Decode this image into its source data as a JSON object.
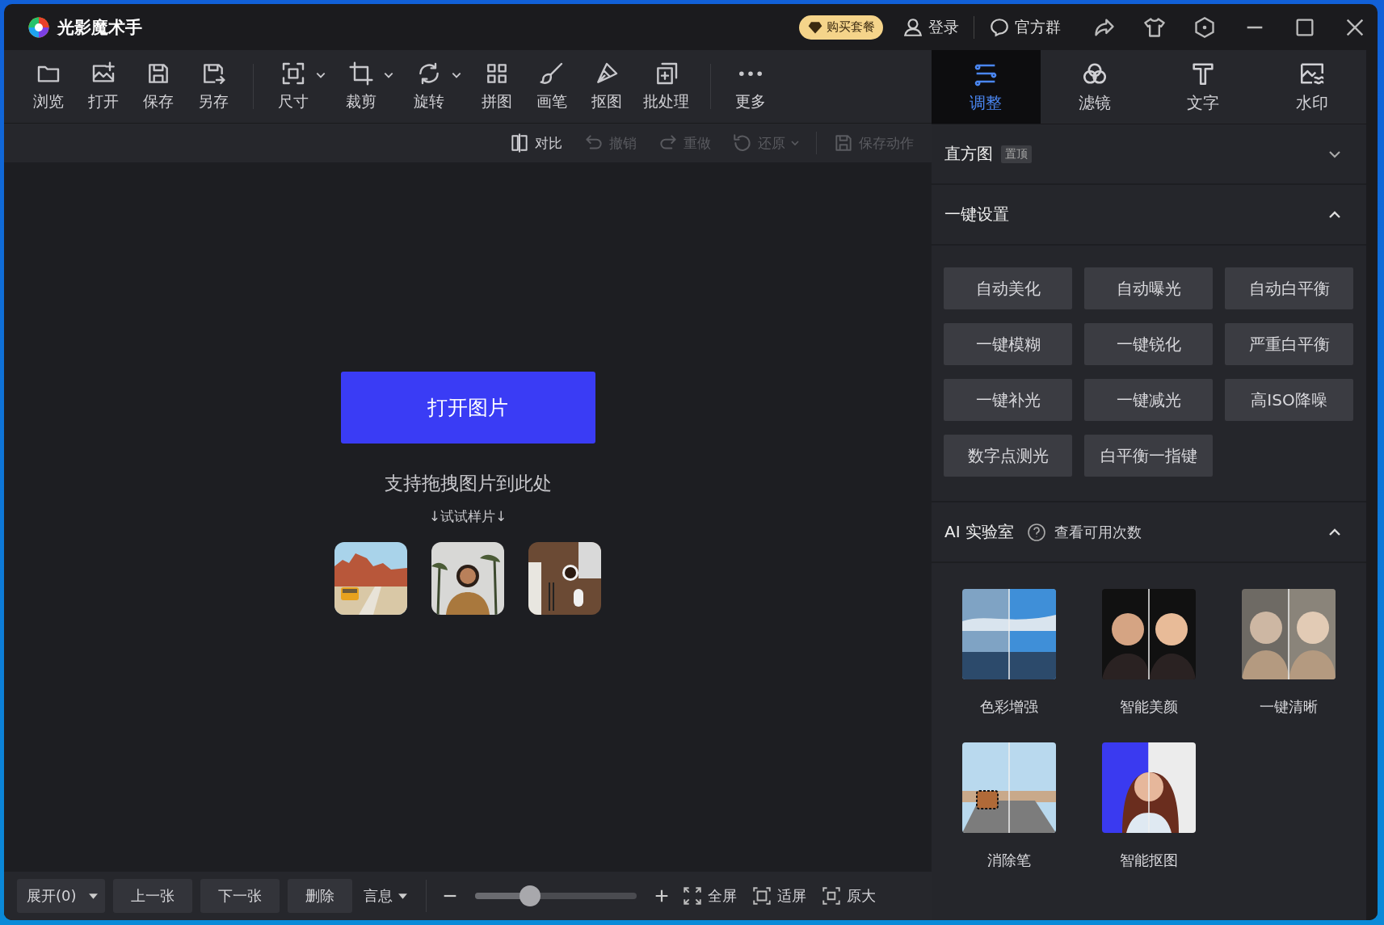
{
  "app": {
    "title": "光影魔术手"
  },
  "header": {
    "purchase": "购买套餐",
    "login": "登录",
    "group": "官方群"
  },
  "toolbar": [
    {
      "items": [
        {
          "label": "浏览",
          "kind": "folder",
          "dropdown": false
        },
        {
          "label": "打开",
          "kind": "image-add",
          "dropdown": false
        },
        {
          "label": "保存",
          "kind": "save",
          "dropdown": false
        },
        {
          "label": "另存",
          "kind": "save-as",
          "dropdown": false
        }
      ]
    },
    {
      "items": [
        {
          "label": "尺寸",
          "kind": "size",
          "dropdown": true
        },
        {
          "label": "裁剪",
          "kind": "crop",
          "dropdown": true
        },
        {
          "label": "旋转",
          "kind": "rotate",
          "dropdown": true
        },
        {
          "label": "拼图",
          "kind": "grid",
          "dropdown": false
        },
        {
          "label": "画笔",
          "kind": "brush",
          "dropdown": false
        },
        {
          "label": "抠图",
          "kind": "pen",
          "dropdown": false
        },
        {
          "label": "批处理",
          "kind": "batch",
          "dropdown": false
        }
      ]
    },
    {
      "items": [
        {
          "label": "更多",
          "kind": "more",
          "dropdown": false
        }
      ]
    }
  ],
  "actions": [
    {
      "label": "对比",
      "kind": "compare",
      "disabled": false,
      "dropdown": false
    },
    {
      "label": "撤销",
      "kind": "undo",
      "disabled": true,
      "dropdown": false
    },
    {
      "label": "重做",
      "kind": "redo",
      "disabled": true,
      "dropdown": false
    },
    {
      "label": "还原",
      "kind": "restore",
      "disabled": true,
      "dropdown": true
    },
    {
      "label": "保存动作",
      "kind": "save",
      "disabled": true,
      "dropdown": false
    }
  ],
  "canvas": {
    "open_button": "打开图片",
    "hint": "支持拖拽图片到此处",
    "samples_label": "↓试试样片↓"
  },
  "bottom_bar": {
    "expand": "展开(0)",
    "prev": "上一张",
    "next": "下一张",
    "delete": "删除",
    "info": "言息",
    "zoom": {
      "level": 0.34
    },
    "fullscreen": "全屏",
    "fit": "适屏",
    "original": "原大"
  },
  "tabs": [
    {
      "label": "调整",
      "kind": "sliders",
      "selected": true
    },
    {
      "label": "滤镜",
      "kind": "circles",
      "selected": false
    },
    {
      "label": "文字",
      "kind": "text",
      "selected": false
    },
    {
      "label": "水印",
      "kind": "watermark",
      "selected": false
    }
  ],
  "histogram": {
    "title": "直方图",
    "badge": "置顶",
    "expanded": false
  },
  "presets": {
    "title": "一键设置",
    "expanded": true,
    "buttons": [
      "自动美化",
      "自动曝光",
      "自动白平衡",
      "一键模糊",
      "一键锐化",
      "严重白平衡",
      "一键补光",
      "一键减光",
      "高ISO降噪",
      "数字点测光",
      "白平衡一指键"
    ]
  },
  "ai_lab": {
    "title": "AI 实验室",
    "link": "查看可用次数",
    "expanded": true,
    "tools": [
      {
        "label": "色彩增强"
      },
      {
        "label": "智能美颜"
      },
      {
        "label": "一键清晰"
      },
      {
        "label": "消除笔"
      },
      {
        "label": "智能抠图"
      }
    ]
  }
}
